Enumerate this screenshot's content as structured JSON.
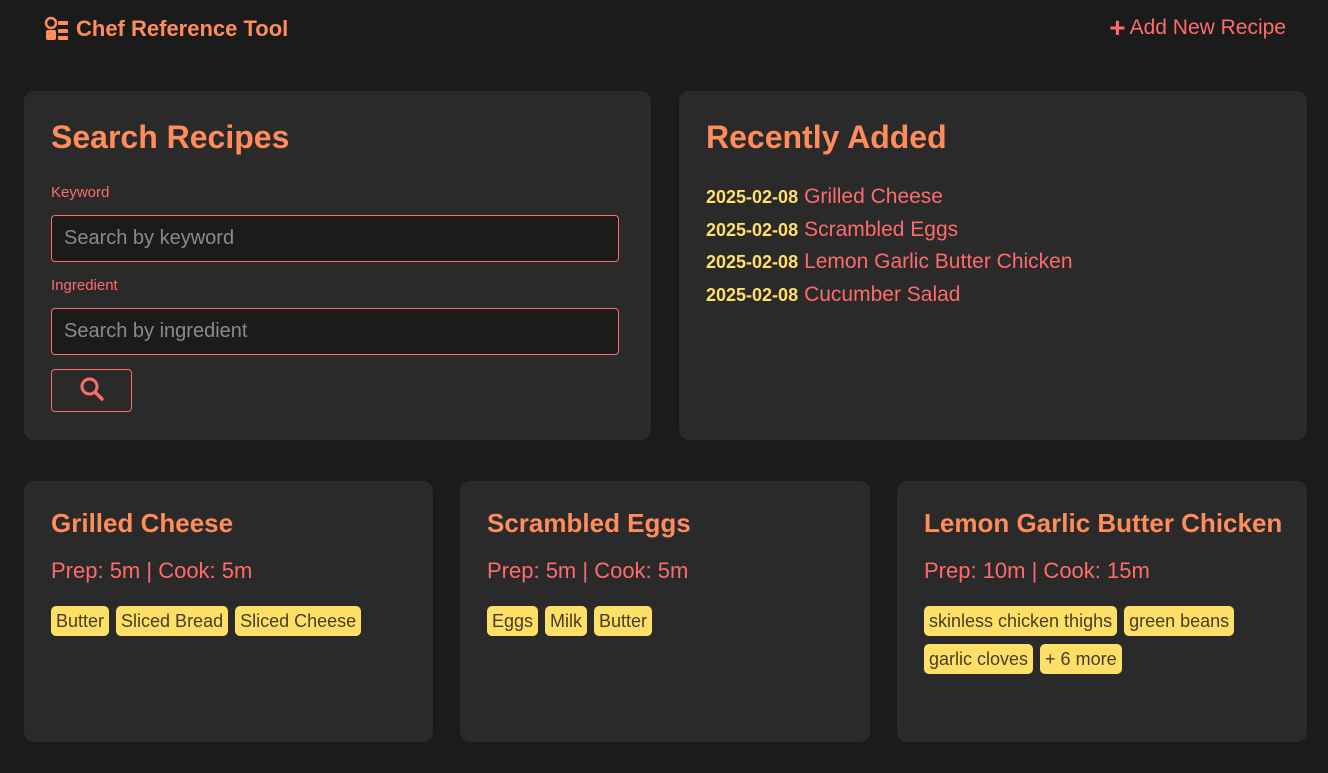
{
  "header": {
    "title": "Chef Reference Tool",
    "add_label": "Add New Recipe"
  },
  "search": {
    "heading": "Search Recipes",
    "keyword_label": "Keyword",
    "keyword_placeholder": "Search by keyword",
    "keyword_value": "",
    "ingredient_label": "Ingredient",
    "ingredient_placeholder": "Search by ingredient",
    "ingredient_value": ""
  },
  "recent": {
    "heading": "Recently Added",
    "items": [
      {
        "date": "2025-02-08",
        "name": "Grilled Cheese"
      },
      {
        "date": "2025-02-08",
        "name": "Scrambled Eggs"
      },
      {
        "date": "2025-02-08",
        "name": "Lemon Garlic Butter Chicken"
      },
      {
        "date": "2025-02-08",
        "name": "Cucumber Salad"
      }
    ]
  },
  "recipes": [
    {
      "title": "Grilled Cheese",
      "times": "Prep: 5m | Cook: 5m",
      "tags": [
        "Butter",
        "Sliced Bread",
        "Sliced Cheese"
      ]
    },
    {
      "title": "Scrambled Eggs",
      "times": "Prep: 5m | Cook: 5m",
      "tags": [
        "Eggs",
        "Milk",
        "Butter"
      ]
    },
    {
      "title": "Lemon Garlic Butter Chicken",
      "times": "Prep: 10m | Cook: 15m",
      "tags": [
        "skinless chicken thighs",
        "green beans",
        "garlic cloves",
        "+ 6 more"
      ]
    }
  ],
  "colors": {
    "background": "#1b1b1b",
    "card": "#2a2a2a",
    "accent": "#ff6b6b",
    "heading": "#ff8c5a",
    "tag": "#ffe066"
  },
  "icons": {
    "brand": "chef-hat-icon",
    "add": "plus-icon",
    "search": "search-icon"
  }
}
